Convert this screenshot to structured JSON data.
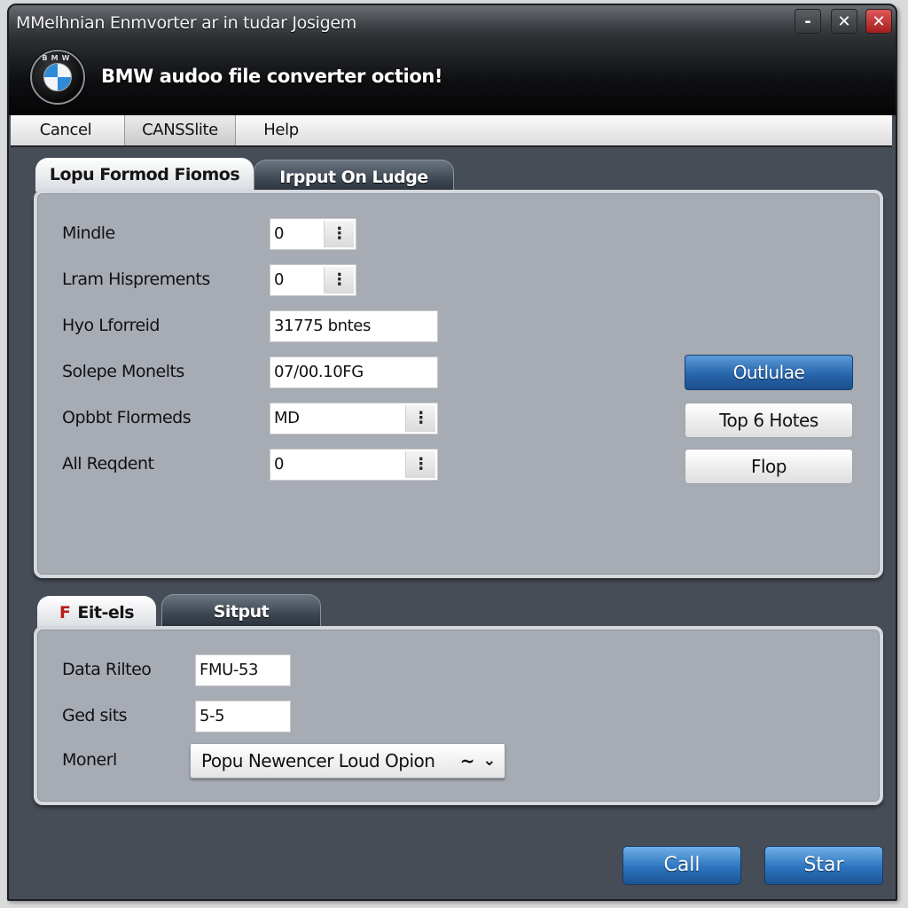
{
  "window": {
    "title": "MMelhnian Enmvorter ar in tudar Josigem",
    "controls": {
      "minimize": "-",
      "maximize": "✕",
      "close": "✕"
    }
  },
  "banner": {
    "logo_letters": "BMW",
    "heading": "BMW audoo file converter oction!"
  },
  "menu": {
    "items": [
      {
        "label": "Cancel"
      },
      {
        "label": "CANSSlite"
      },
      {
        "label": "Help"
      }
    ]
  },
  "top_tabs": [
    {
      "label": "Lopu Formod Fiomos",
      "active": true
    },
    {
      "label": "Irpput On Ludge",
      "active": false
    }
  ],
  "top_panel": {
    "fields": [
      {
        "label": "Mindle",
        "value": "0",
        "spinner": true
      },
      {
        "label": "Lram Hisprements",
        "value": "0",
        "spinner": true
      },
      {
        "label": "Hyo Lforreid",
        "value": "31775 bntes",
        "spinner": false
      },
      {
        "label": "Solepe Monelts",
        "value": "07/00.10FG",
        "spinner": false
      },
      {
        "label": "Opbbt Flormeds",
        "value": "MD",
        "spinner": true
      },
      {
        "label": "All Reqdent",
        "value": "0",
        "spinner": true
      }
    ],
    "spinner_glyph": "⋮",
    "buttons": [
      {
        "label": "Outlulae",
        "style": "primary"
      },
      {
        "label": "Top 6 Hotes",
        "style": "secondary"
      },
      {
        "label": "Flop",
        "style": "secondary"
      }
    ]
  },
  "bottom_tabs": [
    {
      "icon": "F",
      "label": "Eit-els",
      "active": true
    },
    {
      "label": "Sitput",
      "active": false
    }
  ],
  "bottom_panel": {
    "fields": [
      {
        "label": "Data Rilteo",
        "value": "FMU-53"
      },
      {
        "label": "Ged sits",
        "value": "5-5"
      }
    ],
    "dropdown": {
      "label": "Monerl",
      "value": "Popu Newencer Loud Opion",
      "tilde": "~",
      "chevron": "⌄"
    }
  },
  "footer": {
    "buttons": [
      {
        "label": "Call"
      },
      {
        "label": "Star"
      }
    ]
  },
  "colors": {
    "accent_blue": "#2866ac",
    "close_red": "#c22a2a",
    "frame": "#474d57",
    "panel": "#a6abb4"
  }
}
